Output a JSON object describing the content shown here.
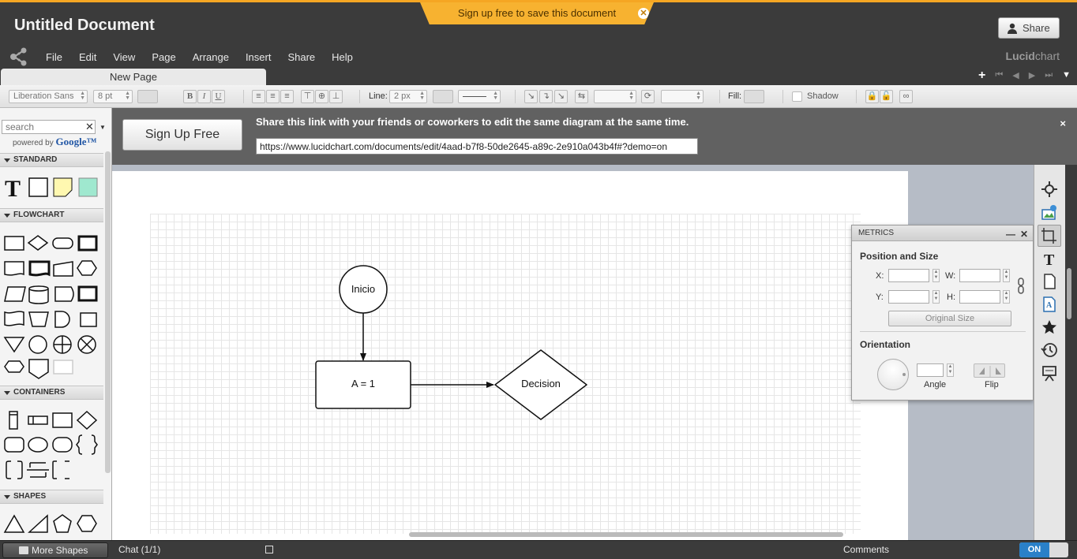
{
  "window": {
    "title": "Untitled Document"
  },
  "banner": {
    "signup_text": "Sign up free to save this document"
  },
  "top_share": {
    "label": "Share"
  },
  "menu": {
    "items": [
      "File",
      "Edit",
      "View",
      "Page",
      "Arrange",
      "Insert",
      "Share",
      "Help"
    ]
  },
  "brand": {
    "main": "Lucid",
    "suffix": "chart"
  },
  "tabs": {
    "page_tab": "New Page"
  },
  "toolbar": {
    "font": "Liberation Sans",
    "font_size": "8 pt",
    "bold": "B",
    "italic": "I",
    "underline": "U",
    "line_label": "Line:",
    "line_width": "2 px",
    "fill_label": "Fill:",
    "shadow_label": "Shadow"
  },
  "share_bar": {
    "signup_button": "Sign Up Free",
    "message": "Share this link with your friends or coworkers to edit the same diagram at the same time.",
    "link": "https://www.lucidchart.com/documents/edit/4aad-b7f8-50de2645-a89c-2e910a043b4f#?demo=on",
    "close": "×"
  },
  "left_panel": {
    "search_placeholder": "search",
    "search_clear": "✕",
    "powered_by": "powered by",
    "google": "Google™",
    "sections": [
      "STANDARD",
      "FLOWCHART",
      "CONTAINERS",
      "SHAPES"
    ]
  },
  "diagram": {
    "start_label": "Inicio",
    "process_label": "A = 1",
    "decision_label": "Decision"
  },
  "metrics": {
    "title": "METRICS",
    "minimize": "—",
    "close": "✕",
    "position_size": "Position and Size",
    "x_label": "X:",
    "w_label": "W:",
    "y_label": "Y:",
    "h_label": "H:",
    "original_size": "Original Size",
    "orientation": "Orientation",
    "angle_label": "Angle",
    "flip_label": "Flip"
  },
  "bottom": {
    "more_shapes": "More Shapes",
    "chat": "Chat (1/1)",
    "comments": "Comments",
    "toggle": "ON"
  },
  "colors": {
    "accent": "#f7b230",
    "toggle_on": "#2a80c8",
    "topbar": "#3b3b3b"
  }
}
